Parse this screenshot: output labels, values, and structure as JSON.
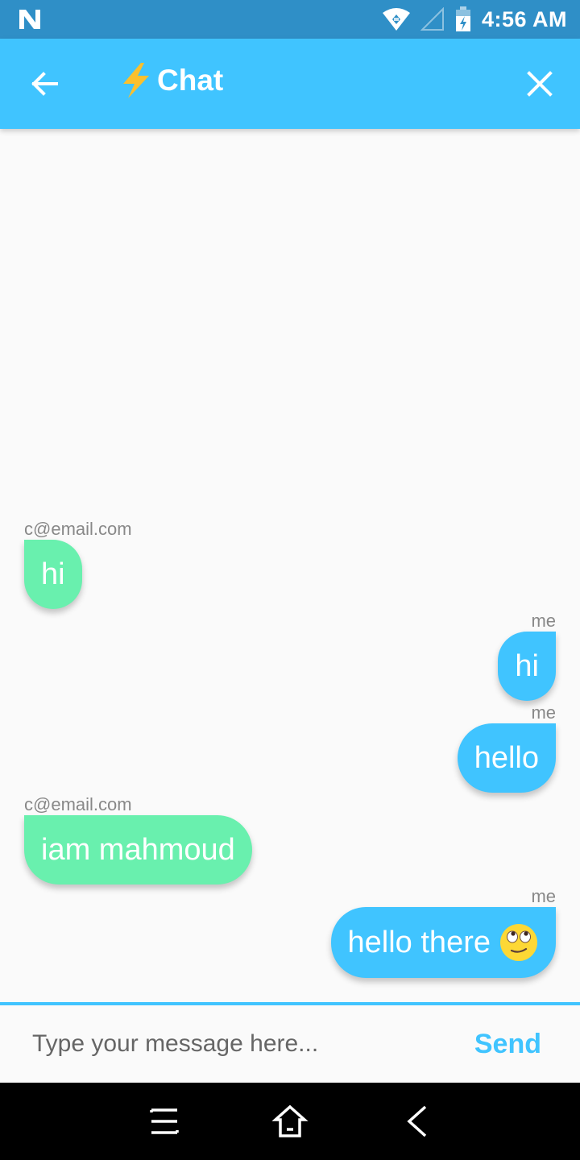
{
  "status_bar": {
    "time": "4:56 AM",
    "icons": [
      "n-logo-icon",
      "wifi-icon",
      "signal-icon",
      "battery-charging-icon"
    ]
  },
  "app_bar": {
    "title": "Chat",
    "title_icon": "lightning-bolt-icon",
    "back_icon": "arrow-back-icon",
    "close_icon": "close-icon",
    "color": "#40c4ff"
  },
  "messages": [
    {
      "sender": "c@email.com",
      "text": "hi",
      "direction": "incoming"
    },
    {
      "sender": "me",
      "text": "hi",
      "direction": "outgoing"
    },
    {
      "sender": "me",
      "text": "hello",
      "direction": "outgoing"
    },
    {
      "sender": "c@email.com",
      "text": "iam mahmoud",
      "direction": "incoming"
    },
    {
      "sender": "me",
      "text": "hello there",
      "direction": "outgoing",
      "emoji": "rolling-eyes-emoji"
    }
  ],
  "colors": {
    "incoming_bubble": "#69f0ae",
    "outgoing_bubble": "#40c4ff",
    "status_bar": "#2f8fc7"
  },
  "composer": {
    "placeholder": "Type your message here...",
    "value": "",
    "send_label": "Send"
  },
  "nav_bar": {
    "icons": [
      "menu-icon",
      "home-icon",
      "back-icon"
    ]
  }
}
